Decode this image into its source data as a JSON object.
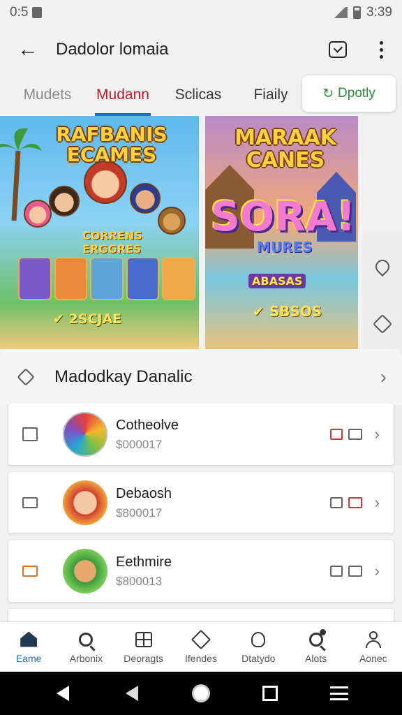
{
  "status_bar": {
    "time_left": "0:5",
    "time_right": "3:39"
  },
  "app_bar": {
    "title": "Dadolor lomaia"
  },
  "tabs": [
    {
      "label": "Mudets"
    },
    {
      "label": "Mudann"
    },
    {
      "label": "Sclicas"
    },
    {
      "label": "Fiaily"
    },
    {
      "label": "Dpotly",
      "icon": "refresh-icon"
    }
  ],
  "banners": [
    {
      "title": "RAFBANIS ECAMES",
      "mid": "CORRENS ERGGRES",
      "foot": "✔ 2SCJAE"
    },
    {
      "title": "MARAAK CANES",
      "mid": "SORA! MURES",
      "mid_small": "SORA!",
      "badge": "ABASAS",
      "foot": "✔ SBSOS"
    }
  ],
  "side_icons": [
    "pin-icon",
    "tag-icon",
    "heart-icon",
    "avatar-icon"
  ],
  "section": {
    "title": "Madodkay Danalic"
  },
  "list": [
    {
      "name": "Cotheolve",
      "price": "$000017",
      "lead_icon": "checkbox-icon",
      "thumb": "colorful-wheel"
    },
    {
      "name": "Debaosh",
      "price": "$800017",
      "lead_icon": "tv-icon",
      "thumb": "girl-avatar"
    },
    {
      "name": "Eethmire",
      "price": "$800013",
      "lead_icon": "tv-icon",
      "thumb": "boy-avatar"
    }
  ],
  "bottom_nav": [
    {
      "label": "Eame",
      "icon": "home-icon",
      "active": true
    },
    {
      "label": "Arbonix",
      "icon": "search-icon",
      "active": false
    },
    {
      "label": "Deoragts",
      "icon": "grid-icon",
      "active": false
    },
    {
      "label": "Ifendes",
      "icon": "cube-icon",
      "active": false
    },
    {
      "label": "Dtatydo",
      "icon": "bulb-icon",
      "active": false
    },
    {
      "label": "Alots",
      "icon": "alert-search-icon",
      "active": false
    },
    {
      "label": "Aonec",
      "icon": "person-icon",
      "active": false
    }
  ],
  "colors": {
    "accent": "#1c6fd1",
    "active_tab_text": "#b3202a",
    "chip_text": "#2a8f3a"
  }
}
